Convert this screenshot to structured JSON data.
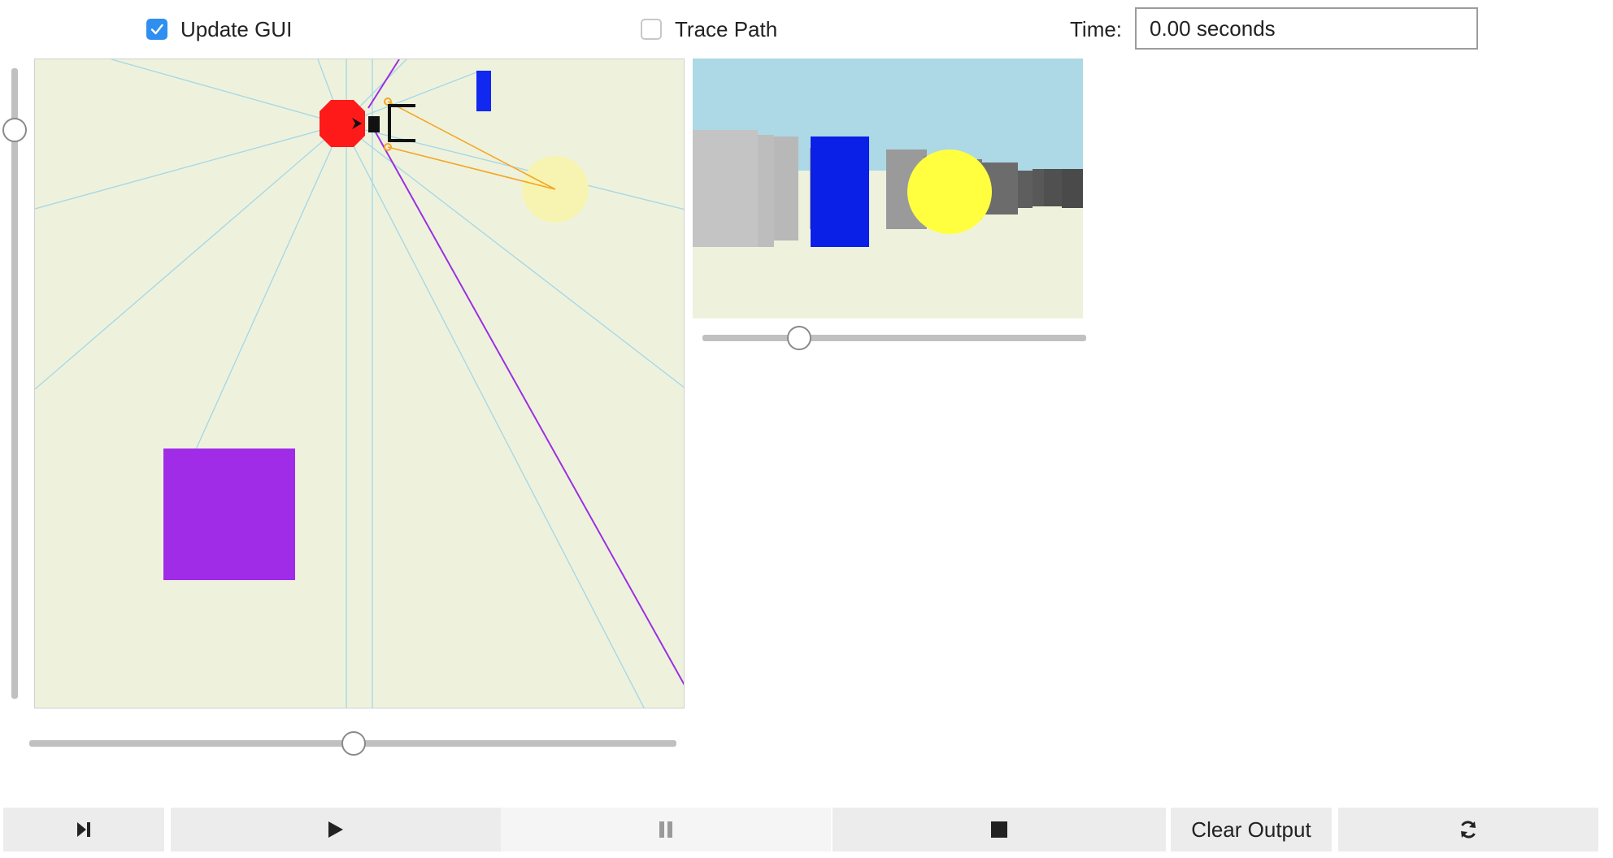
{
  "controls": {
    "update_gui": {
      "label": "Update GUI",
      "checked": true
    },
    "trace_path": {
      "label": "Trace Path",
      "checked": false
    },
    "time_label": "Time:",
    "time_value": "0.00 seconds"
  },
  "world": {
    "background": "#eef2dd",
    "ray_color": "#a8d8e6",
    "robot_color": "#ff1a1a",
    "purple_box_color": "#a02ce8",
    "blue_bar_color": "#1028f0",
    "light_color": "#f6f4b0",
    "sensor_color": "#f5a623",
    "trace_line_color": "#9b30e0"
  },
  "camera": {
    "sky_color": "#add8e6",
    "ground_color": "#eef2dd",
    "blue_color": "#0a20e6",
    "light_color": "#ffff40"
  },
  "sliders": {
    "vertical_zoom": 0.11,
    "horizontal_main": 0.5,
    "camera": 0.25
  },
  "toolbar": {
    "step_icon": "step-forward-icon",
    "play_icon": "play-icon",
    "pause_icon": "pause-icon",
    "stop_icon": "stop-icon",
    "clear_output_label": "Clear Output",
    "refresh_icon": "refresh-icon"
  }
}
